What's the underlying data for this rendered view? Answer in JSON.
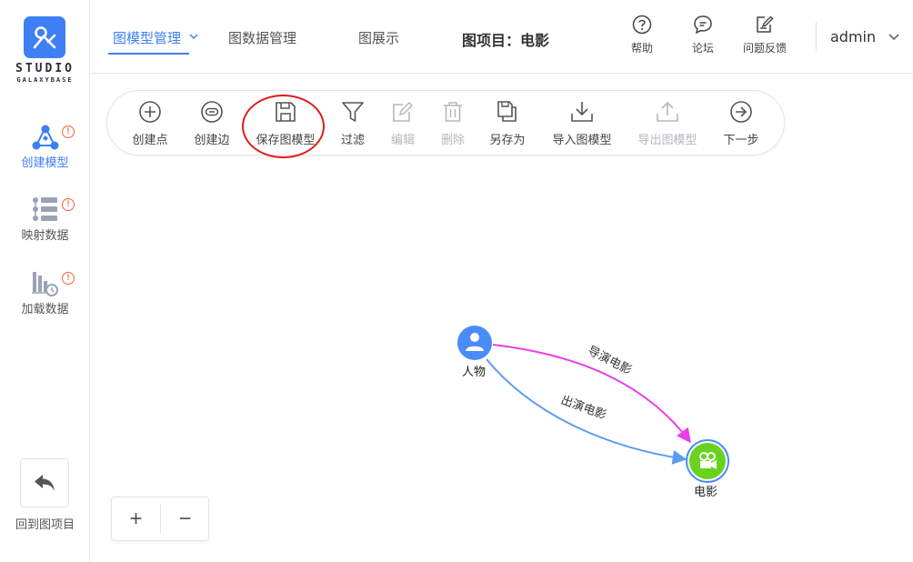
{
  "sidebar": {
    "logo_line1": "STUDIO",
    "logo_line2": "GALAXYBASE",
    "items": [
      {
        "label": "创建模型",
        "badge": "!",
        "active": true
      },
      {
        "label": "映射数据",
        "badge": "!"
      },
      {
        "label": "加载数据",
        "badge": "!"
      }
    ],
    "back_label": "回到图项目"
  },
  "header": {
    "tabs": [
      {
        "label": "图模型管理",
        "active": true
      },
      {
        "label": "图数据管理"
      },
      {
        "label": "图展示"
      }
    ],
    "project_title": "图项目：电影",
    "actions": [
      {
        "label": "帮助",
        "icon": "help-icon"
      },
      {
        "label": "论坛",
        "icon": "forum-icon"
      },
      {
        "label": "问题反馈",
        "icon": "feedback-icon"
      }
    ],
    "user": "admin"
  },
  "toolbar": {
    "tools": [
      {
        "label": "创建点",
        "icon": "plus-circle-icon",
        "enabled": true
      },
      {
        "label": "创建边",
        "icon": "link-icon",
        "enabled": true
      },
      {
        "label": "保存图模型",
        "icon": "save-icon",
        "enabled": true
      },
      {
        "label": "过滤",
        "icon": "filter-icon",
        "enabled": true
      },
      {
        "label": "编辑",
        "icon": "edit-icon",
        "enabled": false
      },
      {
        "label": "删除",
        "icon": "trash-icon",
        "enabled": false
      },
      {
        "label": "另存为",
        "icon": "copy-icon",
        "enabled": true
      },
      {
        "label": "导入图模型",
        "icon": "import-icon",
        "enabled": true
      },
      {
        "label": "导出图模型",
        "icon": "export-icon",
        "enabled": false
      },
      {
        "label": "下一步",
        "icon": "arrow-right-circle-icon",
        "enabled": true
      }
    ]
  },
  "graph": {
    "nodes": [
      {
        "label": "人物",
        "icon": "person-icon",
        "color": "#4a8cf7"
      },
      {
        "label": "电影",
        "icon": "film-icon",
        "color": "#6ad21e"
      }
    ],
    "edges": [
      {
        "label": "导演电影",
        "color": "#e83ee8"
      },
      {
        "label": "出演电影",
        "color": "#5b9bf2"
      }
    ]
  },
  "zoom": {
    "in": "+",
    "out": "−"
  },
  "colors": {
    "accent": "#3f7ff5",
    "annotation": "#e21b1b",
    "badge": "#f0643c"
  }
}
